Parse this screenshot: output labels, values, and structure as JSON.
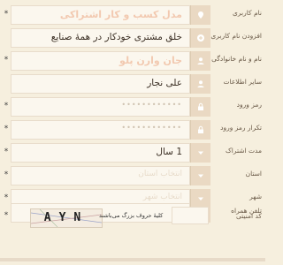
{
  "colors": {
    "background": "#f6efde",
    "icon_box": "#ead9c3",
    "placeholder_accent": "#f2c9b0",
    "label": "#6a5a48"
  },
  "required_marker": "*",
  "fields": {
    "company": {
      "label": "نام کاربری",
      "placeholder": "مدل کسب و کار اشتراکی",
      "icon": "pin-icon"
    },
    "username": {
      "label": "افزودن نام کاربری",
      "value": "خلق مشتری خودکار در همهٔ صنایع",
      "icon": "plus-icon"
    },
    "fullname": {
      "label": "نام و نام خانوادگی",
      "placeholder": "جان وارن پلو",
      "icon": "user-icon"
    },
    "other": {
      "label": "سایر اطلاعات",
      "value": "علی نجار",
      "icon": "user-icon"
    },
    "password": {
      "label": "رمز ورود",
      "placeholder": "••••••••••••",
      "icon": "lock-icon"
    },
    "password_confirm": {
      "label": "تکرار رمز ورود",
      "placeholder": "••••••••••••",
      "icon": "lock-icon"
    },
    "subscription": {
      "label": "مدت اشتراک",
      "value": "1 سال",
      "icon": "chevron-down-icon"
    },
    "province": {
      "label": "استان",
      "placeholder": "انتخاب استان",
      "icon": "chevron-down-icon"
    },
    "city": {
      "label": "شهر",
      "placeholder": "انتخاب شهر",
      "icon": "chevron-down-icon"
    },
    "mobile": {
      "label": "تلفن همراه",
      "placeholder": "",
      "icon": "phone-icon"
    }
  },
  "captcha": {
    "label": "کد امنیتی",
    "code": "AYN",
    "note": "کلیهٔ حروف بزرگ می‌باشند"
  }
}
